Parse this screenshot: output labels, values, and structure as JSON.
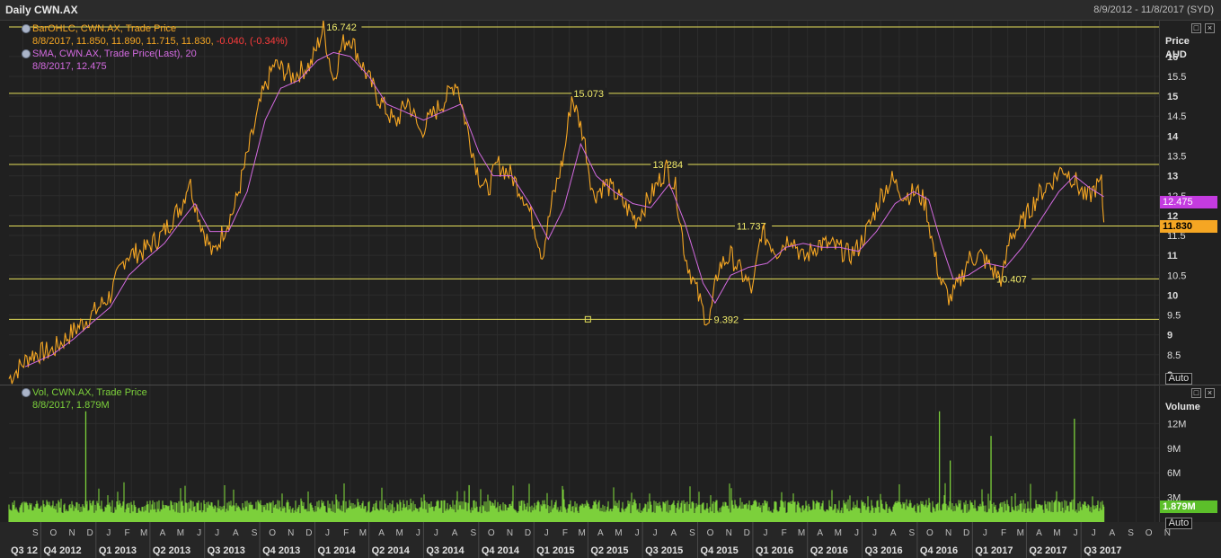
{
  "window": {
    "title": "Daily CWN.AX",
    "date_range": "8/9/2012 - 11/8/2017 (SYD)"
  },
  "price_panel": {
    "legend": [
      {
        "label": "BarOHLC, CWN.AX, Trade Price",
        "value_line": "8/8/2017, 11.850, 11.890, 11.715, 11.830, ",
        "change": "-0.040, (-0.34%)",
        "color": "#f5a623",
        "change_color": "#ff3b3b"
      },
      {
        "label": "SMA, CWN.AX, Trade Price(Last),  20",
        "value_line": "8/8/2017, 12.475",
        "color": "#d36ae0"
      }
    ],
    "axis_title": "Price",
    "axis_unit": "AUD",
    "last_price_tag": "11.830",
    "sma_tag": "12.475",
    "auto_label": "Auto"
  },
  "volume_panel": {
    "legend": {
      "label": "Vol, CWN.AX, Trade Price",
      "value_line": "8/8/2017, 1.879M",
      "color": "#7cd03b"
    },
    "axis_title": "Volume",
    "last_volume_tag": "1.879M",
    "auto_label": "Auto"
  },
  "window_buttons": {
    "restore": "□",
    "close": "×"
  },
  "chart_data": {
    "type": "line",
    "title": "Daily CWN.AX",
    "ylabel": "Price AUD",
    "price_ylim": [
      7.75,
      16.9
    ],
    "price_ticks": [
      8,
      8.5,
      9,
      9.5,
      10,
      10.5,
      11,
      11.5,
      12,
      12.5,
      13,
      13.5,
      14,
      14.5,
      15,
      15.5,
      16
    ],
    "volume_ylim": [
      0,
      13800000
    ],
    "volume_ticks": [
      {
        "v": 3000000,
        "label": "3M"
      },
      {
        "v": 6000000,
        "label": "6M"
      },
      {
        "v": 9000000,
        "label": "9M"
      },
      {
        "v": 12000000,
        "label": "12M"
      }
    ],
    "months": [
      "S",
      "O",
      "N",
      "D",
      "J",
      "F",
      "M",
      "A",
      "M",
      "J",
      "J",
      "A",
      "S",
      "O",
      "N",
      "D",
      "J",
      "F",
      "M",
      "A",
      "M",
      "J",
      "J",
      "A",
      "S",
      "O",
      "N",
      "D",
      "J",
      "F",
      "M",
      "A",
      "M",
      "J",
      "J",
      "A",
      "S",
      "O",
      "N",
      "D",
      "J",
      "F",
      "M",
      "A",
      "M",
      "J",
      "J",
      "A",
      "S",
      "O",
      "N",
      "D",
      "J",
      "F",
      "M",
      "A",
      "M",
      "J",
      "J",
      "A",
      "S",
      "O",
      "N"
    ],
    "quarters": [
      "Q3 12",
      "Q4 2012",
      "Q1 2013",
      "Q2 2013",
      "Q3 2013",
      "Q4 2013",
      "Q1 2014",
      "Q2 2014",
      "Q3 2014",
      "Q4 2014",
      "Q1 2015",
      "Q2 2015",
      "Q3 2015",
      "Q4 2015",
      "Q1 2016",
      "Q2 2016",
      "Q3 2016",
      "Q4 2016",
      "Q1 2017",
      "Q2 2017",
      "Q3 2017"
    ],
    "horizontal_levels": [
      {
        "value": 16.742,
        "label": "16.742"
      },
      {
        "value": 15.073,
        "label": "15.073"
      },
      {
        "value": 13.284,
        "label": "13.284"
      },
      {
        "value": 11.737,
        "label": "11.737"
      },
      {
        "value": 10.407,
        "label": "10.407"
      },
      {
        "value": 9.392,
        "label": "9.392"
      }
    ],
    "series": [
      {
        "name": "BarOHLC, CWN.AX, Trade Price",
        "color": "#f5a623",
        "points": [
          [
            "2012-08-09",
            7.9
          ],
          [
            "2012-09-15",
            8.5
          ],
          [
            "2012-10-20",
            8.6
          ],
          [
            "2012-11-25",
            9.1
          ],
          [
            "2012-12-25",
            9.5
          ],
          [
            "2013-01-25",
            10.0
          ],
          [
            "2013-02-20",
            11.0
          ],
          [
            "2013-03-20",
            11.1
          ],
          [
            "2013-04-20",
            11.5
          ],
          [
            "2013-05-25",
            12.3
          ],
          [
            "2013-06-05",
            12.9
          ],
          [
            "2013-06-25",
            11.8
          ],
          [
            "2013-07-15",
            11.0
          ],
          [
            "2013-08-01",
            11.6
          ],
          [
            "2013-08-20",
            12.2
          ],
          [
            "2013-09-10",
            13.5
          ],
          [
            "2013-10-05",
            15.0
          ],
          [
            "2013-10-25",
            15.8
          ],
          [
            "2013-11-25",
            15.5
          ],
          [
            "2013-12-25",
            15.8
          ],
          [
            "2014-01-15",
            16.7
          ],
          [
            "2014-02-01",
            15.4
          ],
          [
            "2014-02-15",
            16.3
          ],
          [
            "2014-03-01",
            16.5
          ],
          [
            "2014-03-20",
            15.8
          ],
          [
            "2014-04-15",
            15.0
          ],
          [
            "2014-05-15",
            14.3
          ],
          [
            "2014-06-05",
            14.9
          ],
          [
            "2014-06-25",
            14.1
          ],
          [
            "2014-07-20",
            14.6
          ],
          [
            "2014-08-10",
            15.0
          ],
          [
            "2014-08-25",
            15.4
          ],
          [
            "2014-09-10",
            14.3
          ],
          [
            "2014-10-01",
            13.0
          ],
          [
            "2014-10-15",
            12.6
          ],
          [
            "2014-11-01",
            13.3
          ],
          [
            "2014-11-25",
            13.0
          ],
          [
            "2014-12-15",
            12.5
          ],
          [
            "2015-01-01",
            11.8
          ],
          [
            "2015-01-15",
            11.0
          ],
          [
            "2015-02-01",
            12.4
          ],
          [
            "2015-02-20",
            13.5
          ],
          [
            "2015-03-05",
            15.0
          ],
          [
            "2015-03-25",
            14.0
          ],
          [
            "2015-04-10",
            12.5
          ],
          [
            "2015-05-01",
            12.8
          ],
          [
            "2015-05-25",
            12.4
          ],
          [
            "2015-06-20",
            11.9
          ],
          [
            "2015-07-15",
            12.5
          ],
          [
            "2015-08-10",
            13.2
          ],
          [
            "2015-08-25",
            12.7
          ],
          [
            "2015-09-10",
            11.0
          ],
          [
            "2015-09-25",
            10.3
          ],
          [
            "2015-10-10",
            9.6
          ],
          [
            "2015-10-20",
            9.3
          ],
          [
            "2015-11-05",
            10.7
          ],
          [
            "2015-11-25",
            11.0
          ],
          [
            "2015-12-15",
            10.5
          ],
          [
            "2016-01-01",
            10.1
          ],
          [
            "2016-01-15",
            11.6
          ],
          [
            "2016-02-10",
            11.1
          ],
          [
            "2016-03-05",
            11.5
          ],
          [
            "2016-03-25",
            10.9
          ],
          [
            "2016-04-20",
            11.3
          ],
          [
            "2016-05-20",
            11.2
          ],
          [
            "2016-06-10",
            11.0
          ],
          [
            "2016-06-25",
            11.2
          ],
          [
            "2016-07-15",
            11.8
          ],
          [
            "2016-08-01",
            12.5
          ],
          [
            "2016-08-20",
            12.9
          ],
          [
            "2016-09-10",
            12.5
          ],
          [
            "2016-09-30",
            12.6
          ],
          [
            "2016-10-15",
            12.3
          ],
          [
            "2016-10-30",
            11.0
          ],
          [
            "2016-11-10",
            10.3
          ],
          [
            "2016-11-25",
            9.9
          ],
          [
            "2016-12-10",
            10.3
          ],
          [
            "2016-12-25",
            10.9
          ],
          [
            "2017-01-15",
            11.0
          ],
          [
            "2017-02-05",
            10.6
          ],
          [
            "2017-02-20",
            10.4
          ],
          [
            "2017-03-05",
            11.5
          ],
          [
            "2017-03-25",
            11.8
          ],
          [
            "2017-04-20",
            12.5
          ],
          [
            "2017-05-15",
            12.9
          ],
          [
            "2017-06-01",
            13.2
          ],
          [
            "2017-06-20",
            12.9
          ],
          [
            "2017-07-10",
            12.4
          ],
          [
            "2017-07-25",
            12.7
          ],
          [
            "2017-08-04",
            12.8
          ],
          [
            "2017-08-08",
            11.83
          ]
        ]
      },
      {
        "name": "SMA, CWN.AX, Trade Price(Last),  20",
        "color": "#d36ae0",
        "points": [
          [
            "2012-09-05",
            8.2
          ],
          [
            "2012-10-20",
            8.5
          ],
          [
            "2012-11-25",
            8.9
          ],
          [
            "2012-12-25",
            9.3
          ],
          [
            "2013-01-25",
            9.7
          ],
          [
            "2013-02-25",
            10.5
          ],
          [
            "2013-03-25",
            10.9
          ],
          [
            "2013-04-25",
            11.3
          ],
          [
            "2013-05-25",
            11.9
          ],
          [
            "2013-06-15",
            12.3
          ],
          [
            "2013-07-10",
            11.6
          ],
          [
            "2013-08-10",
            11.6
          ],
          [
            "2013-09-10",
            12.6
          ],
          [
            "2013-10-10",
            14.4
          ],
          [
            "2013-11-05",
            15.2
          ],
          [
            "2013-12-05",
            15.4
          ],
          [
            "2014-01-05",
            15.9
          ],
          [
            "2014-02-01",
            16.1
          ],
          [
            "2014-03-01",
            16.0
          ],
          [
            "2014-04-01",
            15.5
          ],
          [
            "2014-05-01",
            14.8
          ],
          [
            "2014-06-01",
            14.6
          ],
          [
            "2014-07-01",
            14.4
          ],
          [
            "2014-08-01",
            14.6
          ],
          [
            "2014-09-01",
            14.8
          ],
          [
            "2014-10-01",
            13.6
          ],
          [
            "2014-10-25",
            13.0
          ],
          [
            "2014-11-25",
            13.0
          ],
          [
            "2014-12-25",
            12.3
          ],
          [
            "2015-01-25",
            11.4
          ],
          [
            "2015-02-20",
            12.2
          ],
          [
            "2015-03-20",
            13.8
          ],
          [
            "2015-04-15",
            13.0
          ],
          [
            "2015-05-15",
            12.6
          ],
          [
            "2015-06-15",
            12.3
          ],
          [
            "2015-07-15",
            12.2
          ],
          [
            "2015-08-15",
            12.8
          ],
          [
            "2015-09-10",
            11.8
          ],
          [
            "2015-10-10",
            10.3
          ],
          [
            "2015-10-30",
            9.8
          ],
          [
            "2015-11-25",
            10.5
          ],
          [
            "2015-12-25",
            10.7
          ],
          [
            "2016-01-25",
            10.8
          ],
          [
            "2016-02-25",
            11.2
          ],
          [
            "2016-03-25",
            11.3
          ],
          [
            "2016-04-25",
            11.2
          ],
          [
            "2016-05-25",
            11.2
          ],
          [
            "2016-06-25",
            11.1
          ],
          [
            "2016-07-25",
            11.6
          ],
          [
            "2016-08-25",
            12.3
          ],
          [
            "2016-09-25",
            12.6
          ],
          [
            "2016-10-20",
            12.4
          ],
          [
            "2016-11-10",
            11.3
          ],
          [
            "2016-11-30",
            10.4
          ],
          [
            "2016-12-25",
            10.5
          ],
          [
            "2017-01-25",
            10.8
          ],
          [
            "2017-02-25",
            10.7
          ],
          [
            "2017-03-25",
            11.2
          ],
          [
            "2017-04-25",
            11.9
          ],
          [
            "2017-05-25",
            12.6
          ],
          [
            "2017-06-20",
            13.0
          ],
          [
            "2017-07-15",
            12.7
          ],
          [
            "2017-08-08",
            12.475
          ]
        ]
      },
      {
        "name": "Vol, CWN.AX, Trade Price",
        "color": "#7cd03b",
        "base_volume": 1800000,
        "spikes": [
          [
            "2012-12-15",
            13500000
          ],
          [
            "2014-09-15",
            4500000
          ],
          [
            "2016-11-07",
            13500000
          ],
          [
            "2016-11-25",
            7500000
          ],
          [
            "2017-02-01",
            10500000
          ],
          [
            "2017-06-20",
            12600000
          ],
          [
            "2017-08-08",
            1879000
          ]
        ]
      }
    ]
  }
}
